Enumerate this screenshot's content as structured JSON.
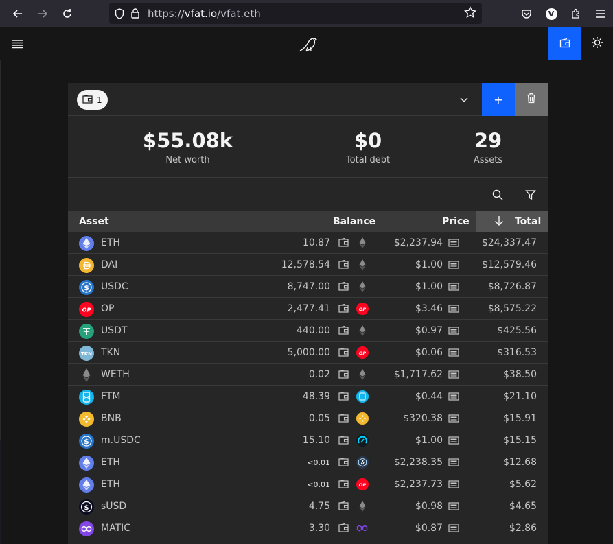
{
  "browser": {
    "url_scheme": "https://",
    "url_domain": "vfat.io",
    "url_path": "/vfat.eth",
    "profile_initial": "V"
  },
  "wallet": {
    "count": "1",
    "add_label": "+"
  },
  "stats": [
    {
      "value": "$55.08k",
      "label": "Net worth"
    },
    {
      "value": "$0",
      "label": "Total debt"
    },
    {
      "value": "29",
      "label": "Assets"
    }
  ],
  "table": {
    "headers": {
      "asset": "Asset",
      "balance": "Balance",
      "price": "Price",
      "total": "Total"
    },
    "rows": [
      {
        "symbol": "ETH",
        "balance": "10.87",
        "price": "$2,237.94",
        "total": "$24,337.47",
        "icon": "eth",
        "chain": "eth"
      },
      {
        "symbol": "DAI",
        "balance": "12,578.54",
        "price": "$1.00",
        "total": "$12,579.46",
        "icon": "dai",
        "chain": "eth"
      },
      {
        "symbol": "USDC",
        "balance": "8,747.00",
        "price": "$1.00",
        "total": "$8,726.87",
        "icon": "usdc",
        "chain": "eth"
      },
      {
        "symbol": "OP",
        "balance": "2,477.41",
        "price": "$3.46",
        "total": "$8,575.22",
        "icon": "op",
        "chain": "op"
      },
      {
        "symbol": "USDT",
        "balance": "440.00",
        "price": "$0.97",
        "total": "$425.56",
        "icon": "usdt",
        "chain": "eth"
      },
      {
        "symbol": "TKN",
        "balance": "5,000.00",
        "price": "$0.06",
        "total": "$316.53",
        "icon": "tkn",
        "chain": "op"
      },
      {
        "symbol": "WETH",
        "balance": "0.02",
        "price": "$1,717.62",
        "total": "$38.50",
        "icon": "weth",
        "chain": "eth"
      },
      {
        "symbol": "FTM",
        "balance": "48.39",
        "price": "$0.44",
        "total": "$21.10",
        "icon": "ftm",
        "chain": "ftm"
      },
      {
        "symbol": "BNB",
        "balance": "0.05",
        "price": "$320.38",
        "total": "$15.91",
        "icon": "bnb",
        "chain": "bnb"
      },
      {
        "symbol": "m.USDC",
        "balance": "15.10",
        "price": "$1.00",
        "total": "$15.15",
        "icon": "usdc",
        "chain": "metis"
      },
      {
        "symbol": "ETH",
        "balance": "<0.01",
        "price": "$2,238.35",
        "total": "$12.68",
        "icon": "eth",
        "chain": "arb"
      },
      {
        "symbol": "ETH",
        "balance": "<0.01",
        "price": "$2,237.73",
        "total": "$5.62",
        "icon": "eth",
        "chain": "op"
      },
      {
        "symbol": "sUSD",
        "balance": "4.75",
        "price": "$0.98",
        "total": "$4.65",
        "icon": "susd",
        "chain": "eth"
      },
      {
        "symbol": "MATIC",
        "balance": "3.30",
        "price": "$0.87",
        "total": "$2.86",
        "icon": "matic",
        "chain": "matic"
      }
    ]
  },
  "colors": {
    "accent": "#0f62fe",
    "eth": "#627eea",
    "dai": "#f4b731",
    "usdc": "#2775ca",
    "op": "#ff0420",
    "usdt": "#26a17b",
    "ftm": "#1969ff",
    "bnb": "#f3ba2f",
    "matic": "#8247e5"
  }
}
